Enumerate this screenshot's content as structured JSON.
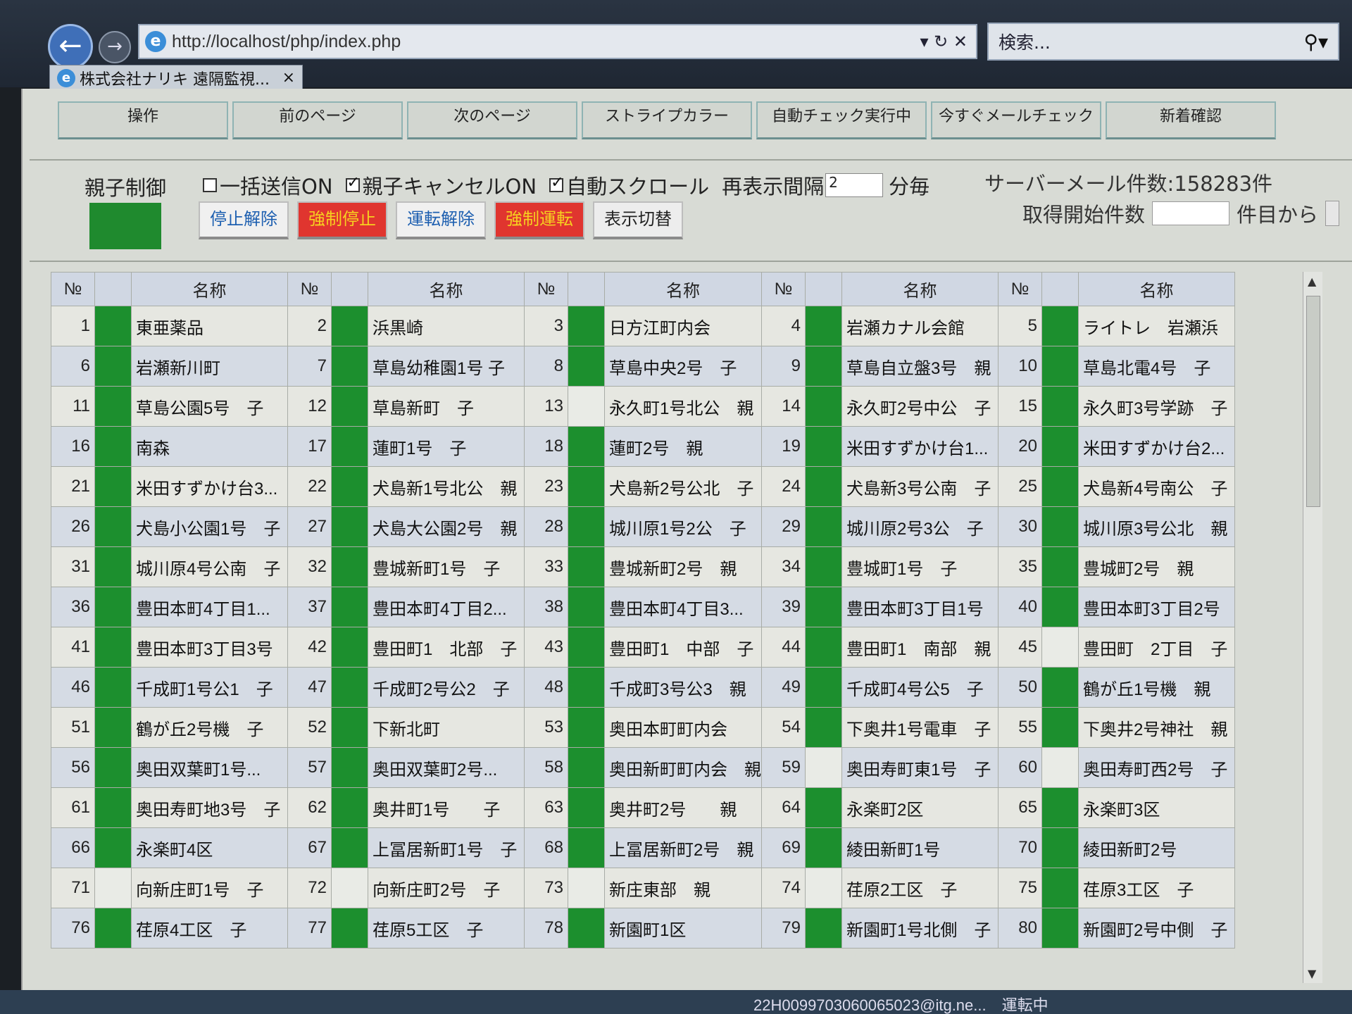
{
  "browser": {
    "url": "http://localhost/php/index.php",
    "search_placeholder": "検索...",
    "tab_title": "株式会社ナリキ 遠隔監視...",
    "tab_close": "×"
  },
  "menu": [
    "操作",
    "前のページ",
    "次のページ",
    "ストライプカラー",
    "自動チェック実行中",
    "今すぐメールチェック",
    "新着確認"
  ],
  "control": {
    "title": "親子制御",
    "status_color": "#1f8a2e",
    "options": [
      {
        "label": "一括送信ON",
        "checked": false
      },
      {
        "label": "親子キャンセルON",
        "checked": true
      },
      {
        "label": "自動スクロール",
        "checked": true
      }
    ],
    "interval_label": "再表示間隔",
    "interval_value": "2",
    "interval_unit": "分毎",
    "server_mail": "サーバーメール件数:158283件",
    "fetch_label": "取得開始件数",
    "fetch_suffix": "件目から",
    "buttons": [
      {
        "label": "停止解除",
        "style": "w"
      },
      {
        "label": "強制停止",
        "style": "r"
      },
      {
        "label": "運転解除",
        "style": "w"
      },
      {
        "label": "強制運転",
        "style": "r"
      },
      {
        "label": "表示切替",
        "style": "g"
      }
    ]
  },
  "table": {
    "header_no": "№",
    "header_name": "名称",
    "rows": [
      [
        {
          "no": "1",
          "name": "東亜薬品",
          "s": "g"
        },
        {
          "no": "2",
          "name": "浜黒崎",
          "s": "g"
        },
        {
          "no": "3",
          "name": "日方江町内会",
          "s": "g"
        },
        {
          "no": "4",
          "name": "岩瀬カナル会館",
          "s": "g"
        },
        {
          "no": "5",
          "name": "ライトレ　岩瀬浜",
          "s": "g"
        }
      ],
      [
        {
          "no": "6",
          "name": "岩瀬新川町",
          "s": "g"
        },
        {
          "no": "7",
          "name": "草島幼稚園1号 子",
          "s": "g"
        },
        {
          "no": "8",
          "name": "草島中央2号　子",
          "s": "g"
        },
        {
          "no": "9",
          "name": "草島自立盤3号　親",
          "s": "g"
        },
        {
          "no": "10",
          "name": "草島北電4号　子",
          "s": "g"
        }
      ],
      [
        {
          "no": "11",
          "name": "草島公園5号　子",
          "s": "g"
        },
        {
          "no": "12",
          "name": "草島新町　子",
          "s": "g"
        },
        {
          "no": "13",
          "name": "永久町1号北公　親",
          "s": "e"
        },
        {
          "no": "14",
          "name": "永久町2号中公　子",
          "s": "g"
        },
        {
          "no": "15",
          "name": "永久町3号学跡　子",
          "s": "g"
        }
      ],
      [
        {
          "no": "16",
          "name": "南森",
          "s": "g"
        },
        {
          "no": "17",
          "name": "蓮町1号　子",
          "s": "g"
        },
        {
          "no": "18",
          "name": "蓮町2号　親",
          "s": "g"
        },
        {
          "no": "19",
          "name": "米田すずかけ台1...",
          "s": "g"
        },
        {
          "no": "20",
          "name": "米田すずかけ台2...",
          "s": "g"
        }
      ],
      [
        {
          "no": "21",
          "name": "米田すずかけ台3...",
          "s": "g"
        },
        {
          "no": "22",
          "name": "犬島新1号北公　親",
          "s": "g"
        },
        {
          "no": "23",
          "name": "犬島新2号公北　子",
          "s": "g"
        },
        {
          "no": "24",
          "name": "犬島新3号公南　子",
          "s": "g"
        },
        {
          "no": "25",
          "name": "犬島新4号南公　子",
          "s": "g"
        }
      ],
      [
        {
          "no": "26",
          "name": "犬島小公園1号　子",
          "s": "g"
        },
        {
          "no": "27",
          "name": "犬島大公園2号　親",
          "s": "g"
        },
        {
          "no": "28",
          "name": "城川原1号2公　子",
          "s": "g"
        },
        {
          "no": "29",
          "name": "城川原2号3公　子",
          "s": "g"
        },
        {
          "no": "30",
          "name": "城川原3号公北　親",
          "s": "g"
        }
      ],
      [
        {
          "no": "31",
          "name": "城川原4号公南　子",
          "s": "g"
        },
        {
          "no": "32",
          "name": "豊城新町1号　子",
          "s": "g"
        },
        {
          "no": "33",
          "name": "豊城新町2号　親",
          "s": "g"
        },
        {
          "no": "34",
          "name": "豊城町1号　子",
          "s": "g"
        },
        {
          "no": "35",
          "name": "豊城町2号　親",
          "s": "g"
        }
      ],
      [
        {
          "no": "36",
          "name": "豊田本町4丁目1...",
          "s": "g"
        },
        {
          "no": "37",
          "name": "豊田本町4丁目2...",
          "s": "g"
        },
        {
          "no": "38",
          "name": "豊田本町4丁目3...",
          "s": "g"
        },
        {
          "no": "39",
          "name": "豊田本町3丁目1号",
          "s": "g"
        },
        {
          "no": "40",
          "name": "豊田本町3丁目2号",
          "s": "g"
        }
      ],
      [
        {
          "no": "41",
          "name": "豊田本町3丁目3号",
          "s": "g"
        },
        {
          "no": "42",
          "name": "豊田町1　北部　子",
          "s": "g"
        },
        {
          "no": "43",
          "name": "豊田町1　中部　子",
          "s": "g"
        },
        {
          "no": "44",
          "name": "豊田町1　南部　親",
          "s": "g"
        },
        {
          "no": "45",
          "name": "豊田町　2丁目　子",
          "s": "e"
        }
      ],
      [
        {
          "no": "46",
          "name": "千成町1号公1　子",
          "s": "g"
        },
        {
          "no": "47",
          "name": "千成町2号公2　子",
          "s": "g"
        },
        {
          "no": "48",
          "name": "千成町3号公3　親",
          "s": "g"
        },
        {
          "no": "49",
          "name": "千成町4号公5　子",
          "s": "g"
        },
        {
          "no": "50",
          "name": "鶴が丘1号機　親",
          "s": "g"
        }
      ],
      [
        {
          "no": "51",
          "name": "鶴が丘2号機　子",
          "s": "g"
        },
        {
          "no": "52",
          "name": "下新北町",
          "s": "g"
        },
        {
          "no": "53",
          "name": "奥田本町町内会",
          "s": "g"
        },
        {
          "no": "54",
          "name": "下奥井1号電車　子",
          "s": "g"
        },
        {
          "no": "55",
          "name": "下奥井2号神社　親",
          "s": "g"
        }
      ],
      [
        {
          "no": "56",
          "name": "奥田双葉町1号...",
          "s": "g"
        },
        {
          "no": "57",
          "name": "奥田双葉町2号...",
          "s": "g"
        },
        {
          "no": "58",
          "name": "奥田新町町内会　親",
          "s": "g"
        },
        {
          "no": "59",
          "name": "奥田寿町東1号　子",
          "s": "e"
        },
        {
          "no": "60",
          "name": "奥田寿町西2号　子",
          "s": "e"
        }
      ],
      [
        {
          "no": "61",
          "name": "奥田寿町地3号　子",
          "s": "g"
        },
        {
          "no": "62",
          "name": "奥井町1号　　子",
          "s": "g"
        },
        {
          "no": "63",
          "name": "奥井町2号　　親",
          "s": "g"
        },
        {
          "no": "64",
          "name": "永楽町2区",
          "s": "g"
        },
        {
          "no": "65",
          "name": "永楽町3区",
          "s": "g"
        }
      ],
      [
        {
          "no": "66",
          "name": "永楽町4区",
          "s": "g"
        },
        {
          "no": "67",
          "name": "上冨居新町1号　子",
          "s": "g"
        },
        {
          "no": "68",
          "name": "上冨居新町2号　親",
          "s": "g"
        },
        {
          "no": "69",
          "name": "綾田新町1号",
          "s": "g"
        },
        {
          "no": "70",
          "name": "綾田新町2号",
          "s": "g"
        }
      ],
      [
        {
          "no": "71",
          "name": "向新庄町1号　子",
          "s": "e"
        },
        {
          "no": "72",
          "name": "向新庄町2号　子",
          "s": "e"
        },
        {
          "no": "73",
          "name": "新庄東部　親",
          "s": "e"
        },
        {
          "no": "74",
          "name": "荏原2工区　子",
          "s": "e"
        },
        {
          "no": "75",
          "name": "荏原3工区　子",
          "s": "g"
        }
      ],
      [
        {
          "no": "76",
          "name": "荏原4工区　子",
          "s": "g"
        },
        {
          "no": "77",
          "name": "荏原5工区　子",
          "s": "g"
        },
        {
          "no": "78",
          "name": "新園町1区",
          "s": "g"
        },
        {
          "no": "79",
          "name": "新園町1号北側　子",
          "s": "g"
        },
        {
          "no": "80",
          "name": "新園町2号中側　子",
          "s": "g"
        }
      ]
    ]
  },
  "taskbar_text": "22H0099703060065023@itg.ne...　運転中"
}
